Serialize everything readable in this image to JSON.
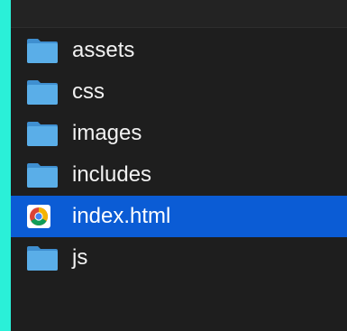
{
  "finder": {
    "items": [
      {
        "name": "assets",
        "type": "folder",
        "selected": false
      },
      {
        "name": "css",
        "type": "folder",
        "selected": false
      },
      {
        "name": "images",
        "type": "folder",
        "selected": false
      },
      {
        "name": "includes",
        "type": "folder",
        "selected": false
      },
      {
        "name": "index.html",
        "type": "html-file",
        "selected": true
      },
      {
        "name": "js",
        "type": "folder",
        "selected": false
      }
    ]
  },
  "colors": {
    "background": "#2af0d8",
    "panel": "#1e1e1e",
    "selection": "#0b5cd5",
    "folder": "#5aaee8"
  }
}
